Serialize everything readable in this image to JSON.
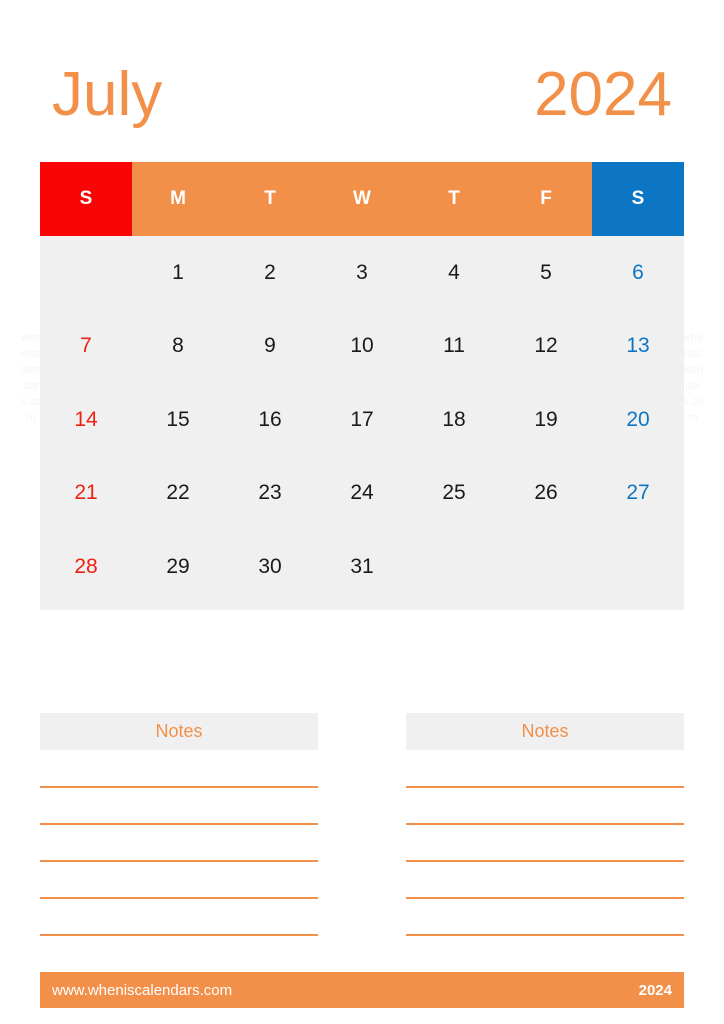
{
  "title": {
    "month": "July",
    "year": "2024"
  },
  "colors": {
    "accent_orange": "#F2904A",
    "sunday_red": "#FA0505",
    "saturday_blue": "#0C76C4",
    "grid_background": "#F0F0F0",
    "date_text": "#1A1A1A",
    "sunday_date_text": "#EE2211",
    "watermark": "#F4F4F4"
  },
  "watermark": {
    "text": "wheniscalendars.com"
  },
  "calendar": {
    "weekday_headers": [
      "S",
      "M",
      "T",
      "W",
      "T",
      "F",
      "S"
    ],
    "weeks": [
      [
        "",
        "1",
        "2",
        "3",
        "4",
        "5",
        "6"
      ],
      [
        "7",
        "8",
        "9",
        "10",
        "11",
        "12",
        "13"
      ],
      [
        "14",
        "15",
        "16",
        "17",
        "18",
        "19",
        "20"
      ],
      [
        "21",
        "22",
        "23",
        "24",
        "25",
        "26",
        "27"
      ],
      [
        "28",
        "29",
        "30",
        "31",
        "",
        "",
        ""
      ]
    ]
  },
  "notes": {
    "left": {
      "title": "Notes",
      "line_count": 5
    },
    "right": {
      "title": "Notes",
      "line_count": 5
    }
  },
  "footer": {
    "url": "www.wheniscalendars.com",
    "year": "2024"
  }
}
